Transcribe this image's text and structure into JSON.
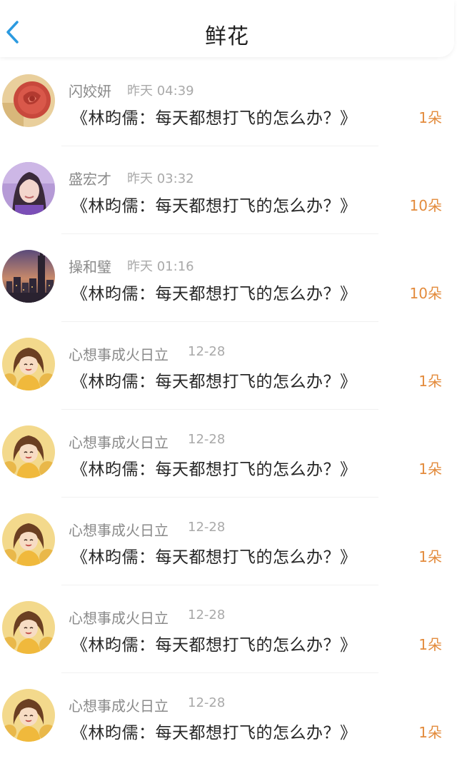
{
  "header": {
    "title": "鲜花",
    "back_icon": "chevron-left-icon",
    "accent_color": "#2b9ae0"
  },
  "colors": {
    "count": "#e38b3c",
    "name": "#8a8a8a",
    "time": "#a9a9a9",
    "book": "#262626"
  },
  "items": [
    {
      "name": "闪姣妍",
      "time": "昨天 04:39",
      "book": "《林昀儒：每天都想打飞的怎么办？》",
      "count": "1朵",
      "avatar": "rose-avatar"
    },
    {
      "name": "盛宏才",
      "time": "昨天 03:32",
      "book": "《林昀儒：每天都想打飞的怎么办？》",
      "count": "10朵",
      "avatar": "girl-photo-avatar"
    },
    {
      "name": "操和璧",
      "time": "昨天 01:16",
      "book": "《林昀儒：每天都想打飞的怎么办？》",
      "count": "10朵",
      "avatar": "city-skyline-avatar"
    },
    {
      "name": "心想事成火日立",
      "time": "12-28",
      "book": "《林昀儒：每天都想打飞的怎么办？》",
      "count": "1朵",
      "avatar": "cartoon-girl-avatar"
    },
    {
      "name": "心想事成火日立",
      "time": "12-28",
      "book": "《林昀儒：每天都想打飞的怎么办？》",
      "count": "1朵",
      "avatar": "cartoon-girl-avatar"
    },
    {
      "name": "心想事成火日立",
      "time": "12-28",
      "book": "《林昀儒：每天都想打飞的怎么办？》",
      "count": "1朵",
      "avatar": "cartoon-girl-avatar"
    },
    {
      "name": "心想事成火日立",
      "time": "12-28",
      "book": "《林昀儒：每天都想打飞的怎么办？》",
      "count": "1朵",
      "avatar": "cartoon-girl-avatar"
    },
    {
      "name": "心想事成火日立",
      "time": "12-28",
      "book": "《林昀儒：每天都想打飞的怎么办？》",
      "count": "1朵",
      "avatar": "cartoon-girl-avatar"
    }
  ]
}
